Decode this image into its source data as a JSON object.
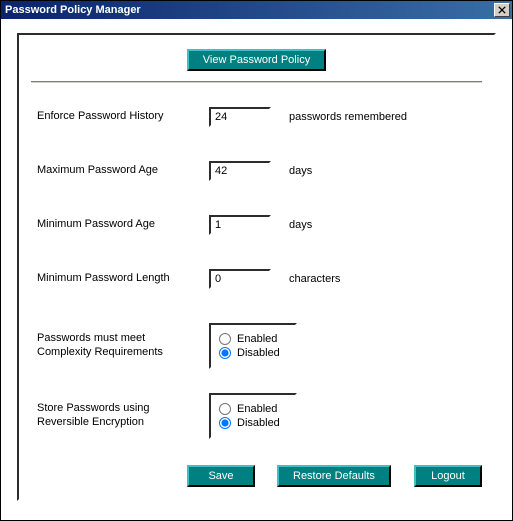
{
  "window": {
    "title": "Password Policy Manager"
  },
  "buttons": {
    "view_policy": "View Password Policy",
    "save": "Save",
    "restore": "Restore Defaults",
    "logout": "Logout"
  },
  "fields": {
    "enforce_history": {
      "label": "Enforce Password History",
      "value": "24",
      "suffix": "passwords remembered"
    },
    "max_age": {
      "label": "Maximum Password Age",
      "value": "42",
      "suffix": "days"
    },
    "min_age": {
      "label": "Minimum Password Age",
      "value": "1",
      "suffix": "days"
    },
    "min_length": {
      "label": "Minimum Password Length",
      "value": "0",
      "suffix": "characters"
    },
    "complexity": {
      "label": "Passwords must meet\nComplexity Requirements",
      "enabled_label": "Enabled",
      "disabled_label": "Disabled",
      "selected": "disabled"
    },
    "reversible": {
      "label": "Store Passwords using\nReversible Encryption",
      "enabled_label": "Enabled",
      "disabled_label": "Disabled",
      "selected": "disabled"
    }
  }
}
